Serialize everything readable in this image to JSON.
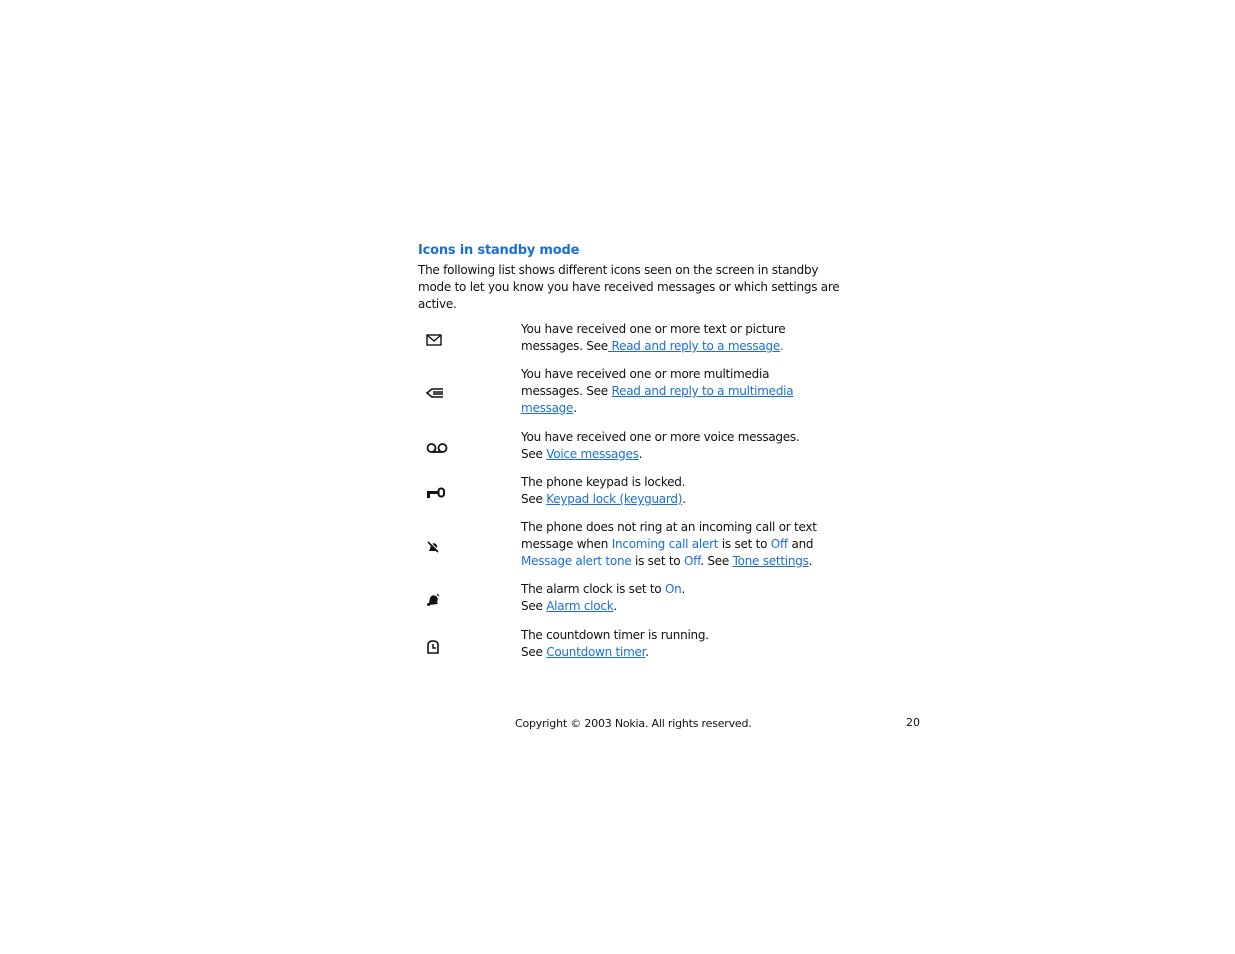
{
  "heading": "Icons in standby mode",
  "intro": "The following list shows different icons seen on the screen in standby mode to let you know you have received messages or which settings are active.",
  "icons": [
    {
      "icon": "envelope-icon",
      "line1": "You have received one or more text or picture",
      "pre": "messages. See",
      "link": " Read and reply to a message",
      "post": "."
    },
    {
      "icon": "multimedia-message-icon",
      "line1": "You have received one or more multimedia",
      "pre": "messages. See ",
      "link": "Read and reply to a multimedia ",
      "link2": "message",
      "post": "."
    },
    {
      "icon": "voicemail-icon",
      "line1": "You have received one or more voice messages.",
      "pre": "See ",
      "link": "Voice messages",
      "post": "."
    },
    {
      "icon": "key-icon",
      "line1": "The phone keypad is locked.",
      "pre": "See ",
      "link": "Keypad lock (keyguard)",
      "post": "."
    },
    {
      "icon": "silent-bell-icon",
      "line1": "The phone does not ring at an incoming call or text",
      "l2_a": "message when ",
      "l2_kw1": "Incoming call alert",
      "l2_b": " is set to ",
      "l2_kw2": "Off",
      "l2_c": " and",
      "l3_kw1": "Message alert tone",
      "l3_a": " is set to ",
      "l3_kw2": "Off",
      "l3_b": ". See ",
      "link": "Tone settings",
      "post": "."
    },
    {
      "icon": "alarm-bell-icon",
      "line1_pre": "The alarm clock is set to ",
      "line1_kw": "On",
      "line1_post": ".",
      "pre": "See ",
      "link": "Alarm clock",
      "post": "."
    },
    {
      "icon": "countdown-timer-icon",
      "line1": "The countdown timer is running.",
      "pre": "See ",
      "link": "Countdown timer",
      "post": "."
    }
  ],
  "footer": {
    "copyright": "Copyright © 2003 Nokia. All rights reserved.",
    "page_number": "20"
  },
  "colors": {
    "accent": "#1a6fd6",
    "text": "#111111"
  }
}
